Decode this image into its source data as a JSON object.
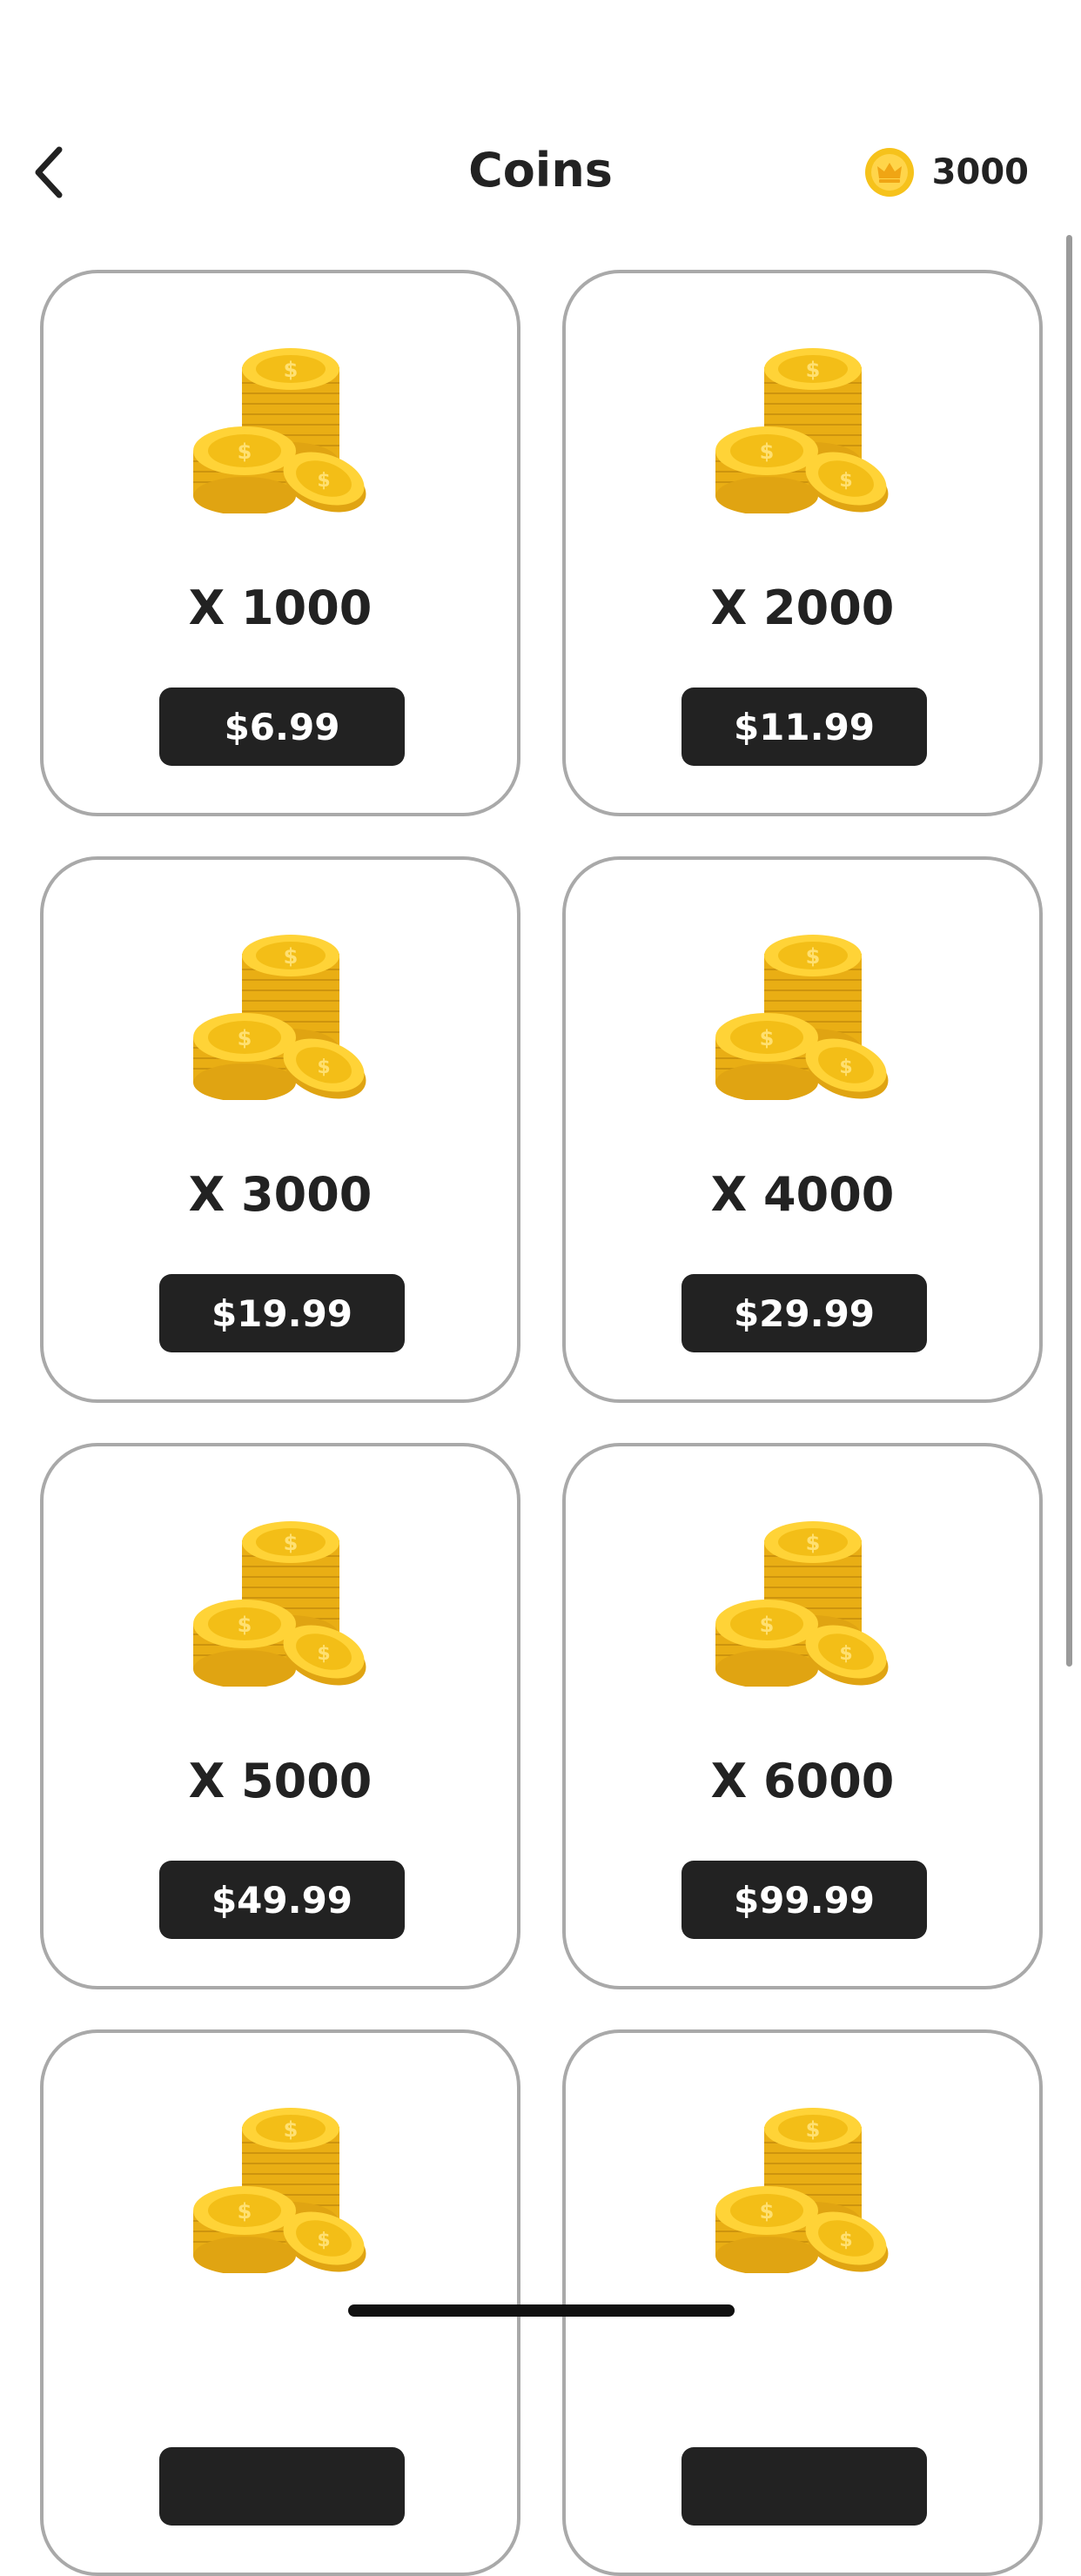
{
  "header": {
    "title": "Coins",
    "balance": "3000",
    "back_icon": "chevron-left-icon",
    "balance_icon": "crown-coin-icon"
  },
  "colors": {
    "coin_gold": "#F5C21B",
    "coin_shadow": "#E0A412",
    "button_dark": "#222222",
    "card_border": "#A9A9A9"
  },
  "packages": [
    {
      "quantity": "X 1000",
      "price": "$6.99"
    },
    {
      "quantity": "X 2000",
      "price": "$11.99"
    },
    {
      "quantity": "X 3000",
      "price": "$19.99"
    },
    {
      "quantity": "X 4000",
      "price": "$29.99"
    },
    {
      "quantity": "X 5000",
      "price": "$49.99"
    },
    {
      "quantity": "X 6000",
      "price": "$99.99"
    },
    {
      "quantity": "",
      "price": ""
    },
    {
      "quantity": "",
      "price": ""
    }
  ]
}
